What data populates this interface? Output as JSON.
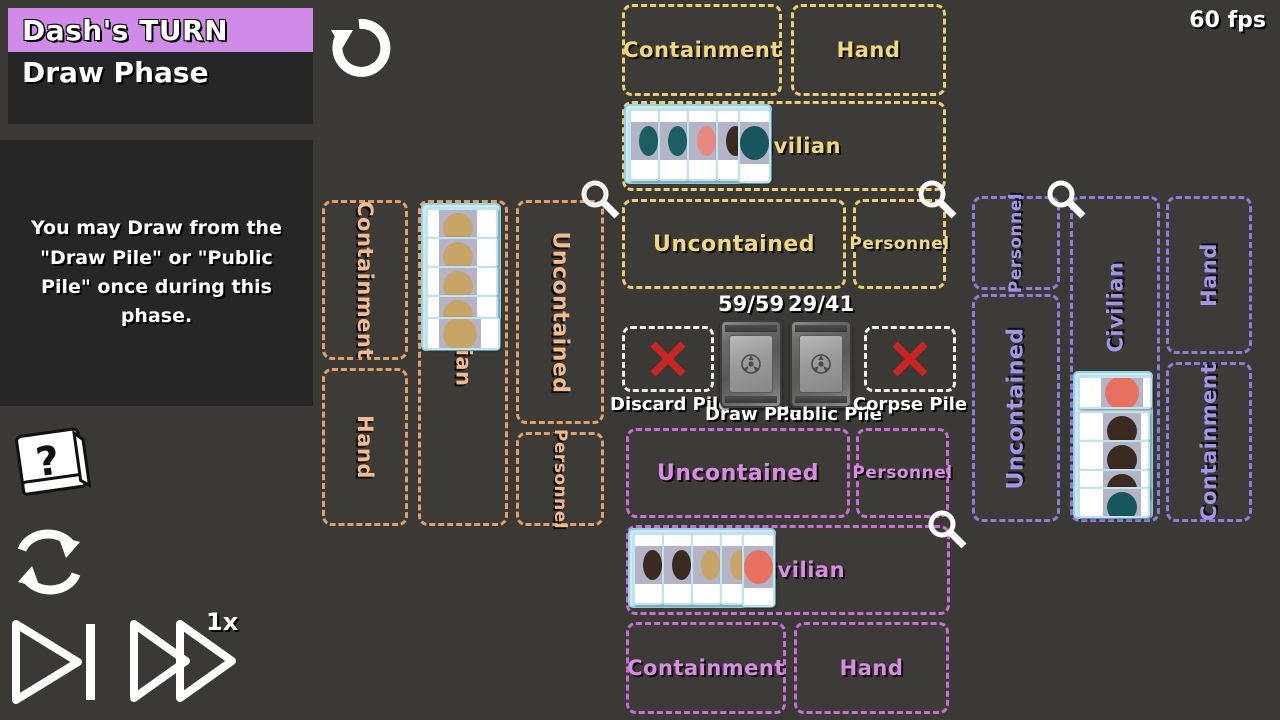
{
  "hud": {
    "turn_label": "Dash's TURN",
    "phase_label": "Draw Phase",
    "instruction": "You may Draw from the \"Draw Pile\" or \"Public Pile\" once during this phase.",
    "fps": "60 fps",
    "speed_multiplier": "1x",
    "undo_icon": "rotate-ccw-icon",
    "help_icon": "help-book-icon",
    "loop_icon": "refresh-loop-icon",
    "step_icon": "play-to-next-icon",
    "fastforward_icon": "fast-forward-icon"
  },
  "colors": {
    "background": "#3b3935",
    "turn_banner": "#d08ae8",
    "panel": "#262626",
    "player_yellow": "#e9cf6d",
    "player_purple": "#c86fd6",
    "player_orange": "#e0a06a",
    "player_periwinkle": "#8c7ddb",
    "x_red": "#cc2222",
    "pile_white": "#f0f0f0"
  },
  "piles": {
    "discard": {
      "label": "Discard Pile",
      "icon": "red-x-icon",
      "empty": true
    },
    "draw": {
      "label": "Draw Pile",
      "count": "59/59",
      "empty": false
    },
    "public": {
      "label": "Public Pile",
      "count": "29/41",
      "empty": false
    },
    "corpse": {
      "label": "Corpse Pile",
      "icon": "red-x-icon",
      "empty": true
    }
  },
  "players": [
    {
      "id": "top",
      "color": "#e9cf6d",
      "position": "top",
      "zones": [
        {
          "name": "containment",
          "label": "Containment",
          "cards": 0
        },
        {
          "name": "hand",
          "label": "Hand",
          "cards": 0
        },
        {
          "name": "civilian",
          "label": "Civilian",
          "cards": 5
        },
        {
          "name": "uncontained",
          "label": "Uncontained",
          "cards": 0
        },
        {
          "name": "personnel",
          "label": "Personnel",
          "cards": 0
        }
      ]
    },
    {
      "id": "bottom",
      "color": "#c86fd6",
      "position": "bottom",
      "zones": [
        {
          "name": "uncontained",
          "label": "Uncontained",
          "cards": 0
        },
        {
          "name": "personnel",
          "label": "Personnel",
          "cards": 0
        },
        {
          "name": "civilian",
          "label": "Civilian",
          "cards": 5
        },
        {
          "name": "containment",
          "label": "Containment",
          "cards": 0
        },
        {
          "name": "hand",
          "label": "Hand",
          "cards": 0
        }
      ]
    },
    {
      "id": "left",
      "color": "#e0a06a",
      "position": "left",
      "zones": [
        {
          "name": "containment",
          "label": "Containment",
          "cards": 0
        },
        {
          "name": "hand",
          "label": "Hand",
          "cards": 0
        },
        {
          "name": "civilian",
          "label": "Civilian",
          "cards": 5
        },
        {
          "name": "uncontained",
          "label": "Uncontained",
          "cards": 0
        },
        {
          "name": "personnel",
          "label": "Personnel",
          "cards": 0
        }
      ]
    },
    {
      "id": "right",
      "color": "#8c7ddb",
      "position": "right",
      "zones": [
        {
          "name": "personnel",
          "label": "Personnel",
          "cards": 0
        },
        {
          "name": "uncontained",
          "label": "Uncontained",
          "cards": 0
        },
        {
          "name": "civilian",
          "label": "Civilian",
          "cards": 5
        },
        {
          "name": "hand",
          "label": "Hand",
          "cards": 0
        },
        {
          "name": "containment",
          "label": "Containment",
          "cards": 0
        }
      ]
    }
  ],
  "magnifiers": [
    {
      "name": "zoom-left-civilian",
      "icon": "magnifier-icon"
    },
    {
      "name": "zoom-top-personnel",
      "icon": "magnifier-icon"
    },
    {
      "name": "zoom-right-civilian",
      "icon": "magnifier-icon"
    },
    {
      "name": "zoom-bottom-personnel",
      "icon": "magnifier-icon"
    }
  ]
}
